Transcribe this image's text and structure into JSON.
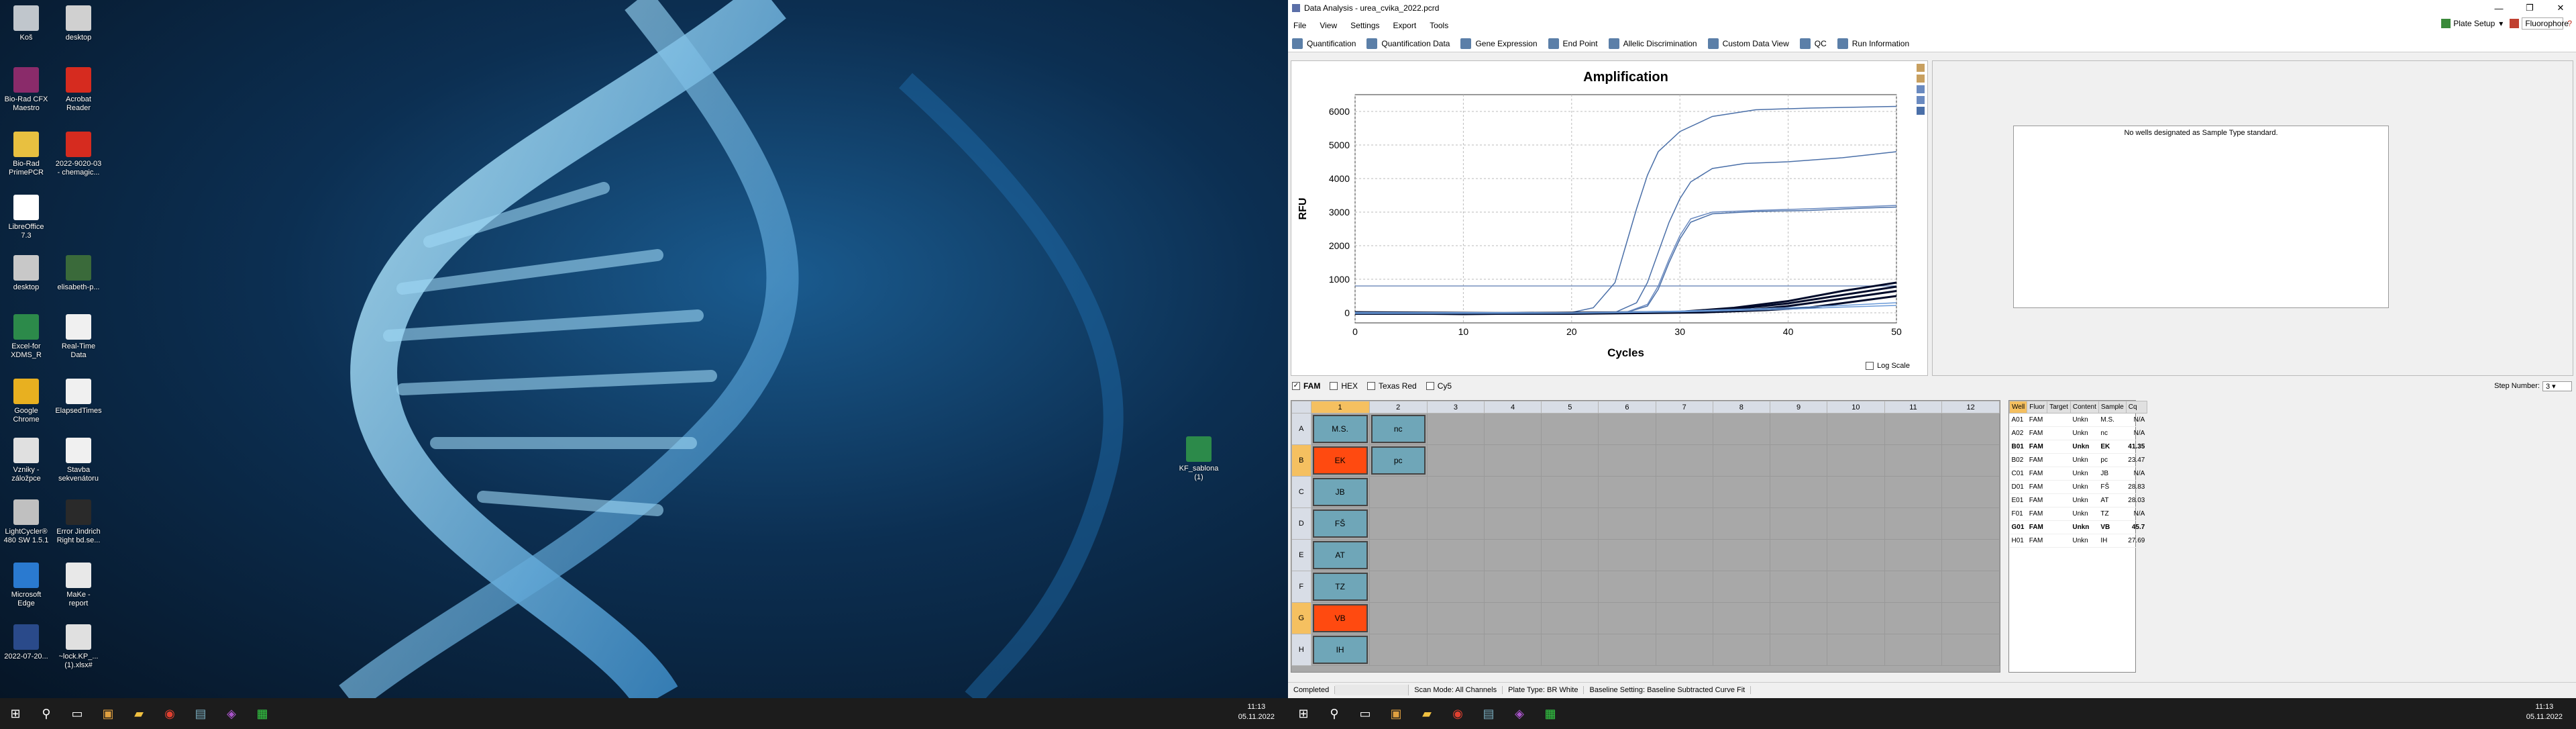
{
  "desktop": {
    "icons": [
      {
        "label": "Koš",
        "color": "#c0c6cc"
      },
      {
        "label": "desktop",
        "color": "#d0d0d0"
      },
      {
        "label": "Bio-Rad CFX\nMaestro",
        "color": "#8a2b6a"
      },
      {
        "label": "Acrobat\nReader",
        "color": "#d62b1f"
      },
      {
        "label": "Bio-Rad\nPrimePCR",
        "color": "#e8c040"
      },
      {
        "label": "2022-9020-03\n- chemagic...",
        "color": "#d62b1f"
      },
      {
        "label": "LibreOffice\n7.3",
        "color": "#ffffff"
      },
      {
        "label": "desktop",
        "color": "#c8c8c8"
      },
      {
        "label": "elisabeth-p...",
        "color": "#3a6a3a"
      },
      {
        "label": "Excel-for\nXDMS_R",
        "color": "#2c8a4a"
      },
      {
        "label": "Real-Time\nData",
        "color": "#f0f0f0"
      },
      {
        "label": "Google\nChrome",
        "color": "#e8b020"
      },
      {
        "label": "ElapsedTimes",
        "color": "#f0f0f0"
      },
      {
        "label": "Vzniky -\nzáložpce",
        "color": "#e0e0e0"
      },
      {
        "label": "Stavba\nsekvenátoru",
        "color": "#f0f0f0"
      },
      {
        "label": "LightCycler®\n480 SW 1.5.1",
        "color": "#c0c0c0"
      },
      {
        "label": "Error Jindrich\nRight bd.se...",
        "color": "#2a2a2a"
      },
      {
        "label": "Microsoft\nEdge",
        "color": "#2a7ad0"
      },
      {
        "label": "MaKe -\nreport",
        "color": "#e8e8e8"
      },
      {
        "label": "2022-07-20...",
        "color": "#2a4a8a"
      },
      {
        "label": "~lock.KP_...\n(1).xlsx#",
        "color": "#e0e0e0"
      },
      {
        "label": "KF_sablona\n(1)",
        "color": "#2c8a4a"
      }
    ],
    "clock_time": "11:13",
    "clock_date": "05.11.2022"
  },
  "app": {
    "title": "Data Analysis - urea_cvika_2022.pcrd",
    "menu": [
      "File",
      "View",
      "Settings",
      "Export",
      "Tools"
    ],
    "plate_setup": "Plate Setup",
    "fluorophore": "Fluorophore",
    "tabs": [
      "Quantification",
      "Quantification Data",
      "Gene Expression",
      "End Point",
      "Allelic Discrimination",
      "Custom Data View",
      "QC",
      "Run Information"
    ],
    "std_message": "No wells designated as Sample Type standard.",
    "fluors": [
      {
        "name": "FAM",
        "checked": true
      },
      {
        "name": "HEX",
        "checked": false
      },
      {
        "name": "Texas Red",
        "checked": false
      },
      {
        "name": "Cy5",
        "checked": false
      }
    ],
    "step_label": "Step Number:",
    "step_value": "3",
    "log_scale": "Log Scale",
    "plate_cols": [
      "1",
      "2",
      "3",
      "4",
      "5",
      "6",
      "7",
      "8",
      "9",
      "10",
      "11",
      "12"
    ],
    "plate_rows": [
      "A",
      "B",
      "C",
      "D",
      "E",
      "F",
      "G",
      "H"
    ],
    "wells": [
      {
        "row": "A",
        "col": 1,
        "label": "M.S.",
        "color": "#6fa6b8"
      },
      {
        "row": "A",
        "col": 2,
        "label": "nc",
        "color": "#6fa6b8"
      },
      {
        "row": "B",
        "col": 1,
        "label": "EK",
        "color": "#ff4a10"
      },
      {
        "row": "B",
        "col": 2,
        "label": "pc",
        "color": "#6fa6b8"
      },
      {
        "row": "C",
        "col": 1,
        "label": "JB",
        "color": "#6fa6b8"
      },
      {
        "row": "D",
        "col": 1,
        "label": "FŠ",
        "color": "#6fa6b8"
      },
      {
        "row": "E",
        "col": 1,
        "label": "AT",
        "color": "#6fa6b8"
      },
      {
        "row": "F",
        "col": 1,
        "label": "TZ",
        "color": "#6fa6b8"
      },
      {
        "row": "G",
        "col": 1,
        "label": "VB",
        "color": "#ff4a10"
      },
      {
        "row": "H",
        "col": 1,
        "label": "IH",
        "color": "#6fa6b8"
      }
    ],
    "table_headers": [
      "Well",
      "Fluor",
      "Target",
      "Content",
      "Sample",
      "Cq"
    ],
    "table_rows": [
      {
        "well": "A01",
        "fluor": "FAM",
        "target": "",
        "content": "Unkn",
        "sample": "M.S.",
        "cq": "N/A",
        "bold": false
      },
      {
        "well": "A02",
        "fluor": "FAM",
        "target": "",
        "content": "Unkn",
        "sample": "nc",
        "cq": "N/A",
        "bold": false
      },
      {
        "well": "B01",
        "fluor": "FAM",
        "target": "",
        "content": "Unkn",
        "sample": "EK",
        "cq": "41.35",
        "bold": true
      },
      {
        "well": "B02",
        "fluor": "FAM",
        "target": "",
        "content": "Unkn",
        "sample": "pc",
        "cq": "23.47",
        "bold": false
      },
      {
        "well": "C01",
        "fluor": "FAM",
        "target": "",
        "content": "Unkn",
        "sample": "JB",
        "cq": "N/A",
        "bold": false
      },
      {
        "well": "D01",
        "fluor": "FAM",
        "target": "",
        "content": "Unkn",
        "sample": "FŠ",
        "cq": "28.83",
        "bold": false
      },
      {
        "well": "E01",
        "fluor": "FAM",
        "target": "",
        "content": "Unkn",
        "sample": "AT",
        "cq": "28.03",
        "bold": false
      },
      {
        "well": "F01",
        "fluor": "FAM",
        "target": "",
        "content": "Unkn",
        "sample": "TZ",
        "cq": "N/A",
        "bold": false
      },
      {
        "well": "G01",
        "fluor": "FAM",
        "target": "",
        "content": "Unkn",
        "sample": "VB",
        "cq": "45.7",
        "bold": true
      },
      {
        "well": "H01",
        "fluor": "FAM",
        "target": "",
        "content": "Unkn",
        "sample": "IH",
        "cq": "27.69",
        "bold": false
      }
    ],
    "status": [
      "Completed",
      "",
      "Scan Mode: All Channels",
      "Plate Type: BR White",
      "Baseline Setting: Baseline Subtracted Curve Fit"
    ],
    "clock_time": "11:13",
    "clock_date": "05.11.2022"
  },
  "chart_data": {
    "type": "line",
    "title": "Amplification",
    "xlabel": "Cycles",
    "ylabel": "RFU",
    "xlim": [
      0,
      50
    ],
    "ylim": [
      -300,
      6500
    ],
    "xticks": [
      0,
      10,
      20,
      30,
      40,
      50
    ],
    "yticks": [
      0,
      1000,
      2000,
      3000,
      4000,
      5000,
      6000
    ],
    "threshold": 800,
    "series": [
      {
        "color": "#4a6fa8",
        "values": [
          [
            0,
            0
          ],
          [
            20,
            10
          ],
          [
            22,
            150
          ],
          [
            24,
            900
          ],
          [
            25,
            2000
          ],
          [
            26,
            3100
          ],
          [
            27,
            4100
          ],
          [
            28,
            4800
          ],
          [
            30,
            5400
          ],
          [
            33,
            5850
          ],
          [
            37,
            6050
          ],
          [
            42,
            6100
          ],
          [
            50,
            6150
          ]
        ]
      },
      {
        "color": "#4a6fa8",
        "values": [
          [
            0,
            0
          ],
          [
            24,
            10
          ],
          [
            26,
            300
          ],
          [
            27,
            900
          ],
          [
            28,
            1800
          ],
          [
            29,
            2700
          ],
          [
            30,
            3400
          ],
          [
            31,
            3900
          ],
          [
            33,
            4300
          ],
          [
            36,
            4450
          ],
          [
            40,
            4500
          ],
          [
            45,
            4620
          ],
          [
            50,
            4800
          ]
        ]
      },
      {
        "color": "#4a6fa8",
        "values": [
          [
            0,
            0
          ],
          [
            25,
            10
          ],
          [
            27,
            200
          ],
          [
            28,
            700
          ],
          [
            29,
            1500
          ],
          [
            30,
            2200
          ],
          [
            31,
            2700
          ],
          [
            33,
            2950
          ],
          [
            37,
            3020
          ],
          [
            42,
            3050
          ],
          [
            47,
            3120
          ],
          [
            50,
            3150
          ]
        ]
      },
      {
        "color": "#6a8ac0",
        "values": [
          [
            0,
            0
          ],
          [
            25,
            10
          ],
          [
            27,
            250
          ],
          [
            28,
            800
          ],
          [
            29,
            1600
          ],
          [
            30,
            2300
          ],
          [
            31,
            2800
          ],
          [
            33,
            3000
          ],
          [
            37,
            3050
          ],
          [
            42,
            3100
          ],
          [
            50,
            3200
          ]
        ]
      },
      {
        "color": "#000a2a",
        "values": [
          [
            0,
            0
          ],
          [
            10,
            -20
          ],
          [
            30,
            30
          ],
          [
            35,
            150
          ],
          [
            40,
            350
          ],
          [
            45,
            650
          ],
          [
            50,
            900
          ]
        ]
      },
      {
        "color": "#000a2a",
        "values": [
          [
            0,
            -10
          ],
          [
            10,
            -40
          ],
          [
            30,
            20
          ],
          [
            35,
            110
          ],
          [
            40,
            280
          ],
          [
            45,
            530
          ],
          [
            50,
            780
          ]
        ]
      },
      {
        "color": "#000a2a",
        "values": [
          [
            0,
            20
          ],
          [
            15,
            -10
          ],
          [
            30,
            10
          ],
          [
            36,
            80
          ],
          [
            40,
            200
          ],
          [
            45,
            420
          ],
          [
            50,
            650
          ]
        ]
      },
      {
        "color": "#000a2a",
        "values": [
          [
            0,
            -30
          ],
          [
            20,
            -30
          ],
          [
            32,
            10
          ],
          [
            38,
            80
          ],
          [
            42,
            160
          ],
          [
            46,
            330
          ],
          [
            50,
            500
          ]
        ]
      },
      {
        "color": "#6a9ad8",
        "values": [
          [
            0,
            10
          ],
          [
            20,
            0
          ],
          [
            30,
            50
          ],
          [
            40,
            150
          ],
          [
            45,
            220
          ],
          [
            50,
            300
          ]
        ]
      },
      {
        "color": "#6a9ad8",
        "values": [
          [
            0,
            -20
          ],
          [
            20,
            -10
          ],
          [
            30,
            30
          ],
          [
            40,
            110
          ],
          [
            45,
            170
          ],
          [
            50,
            220
          ]
        ]
      }
    ]
  }
}
